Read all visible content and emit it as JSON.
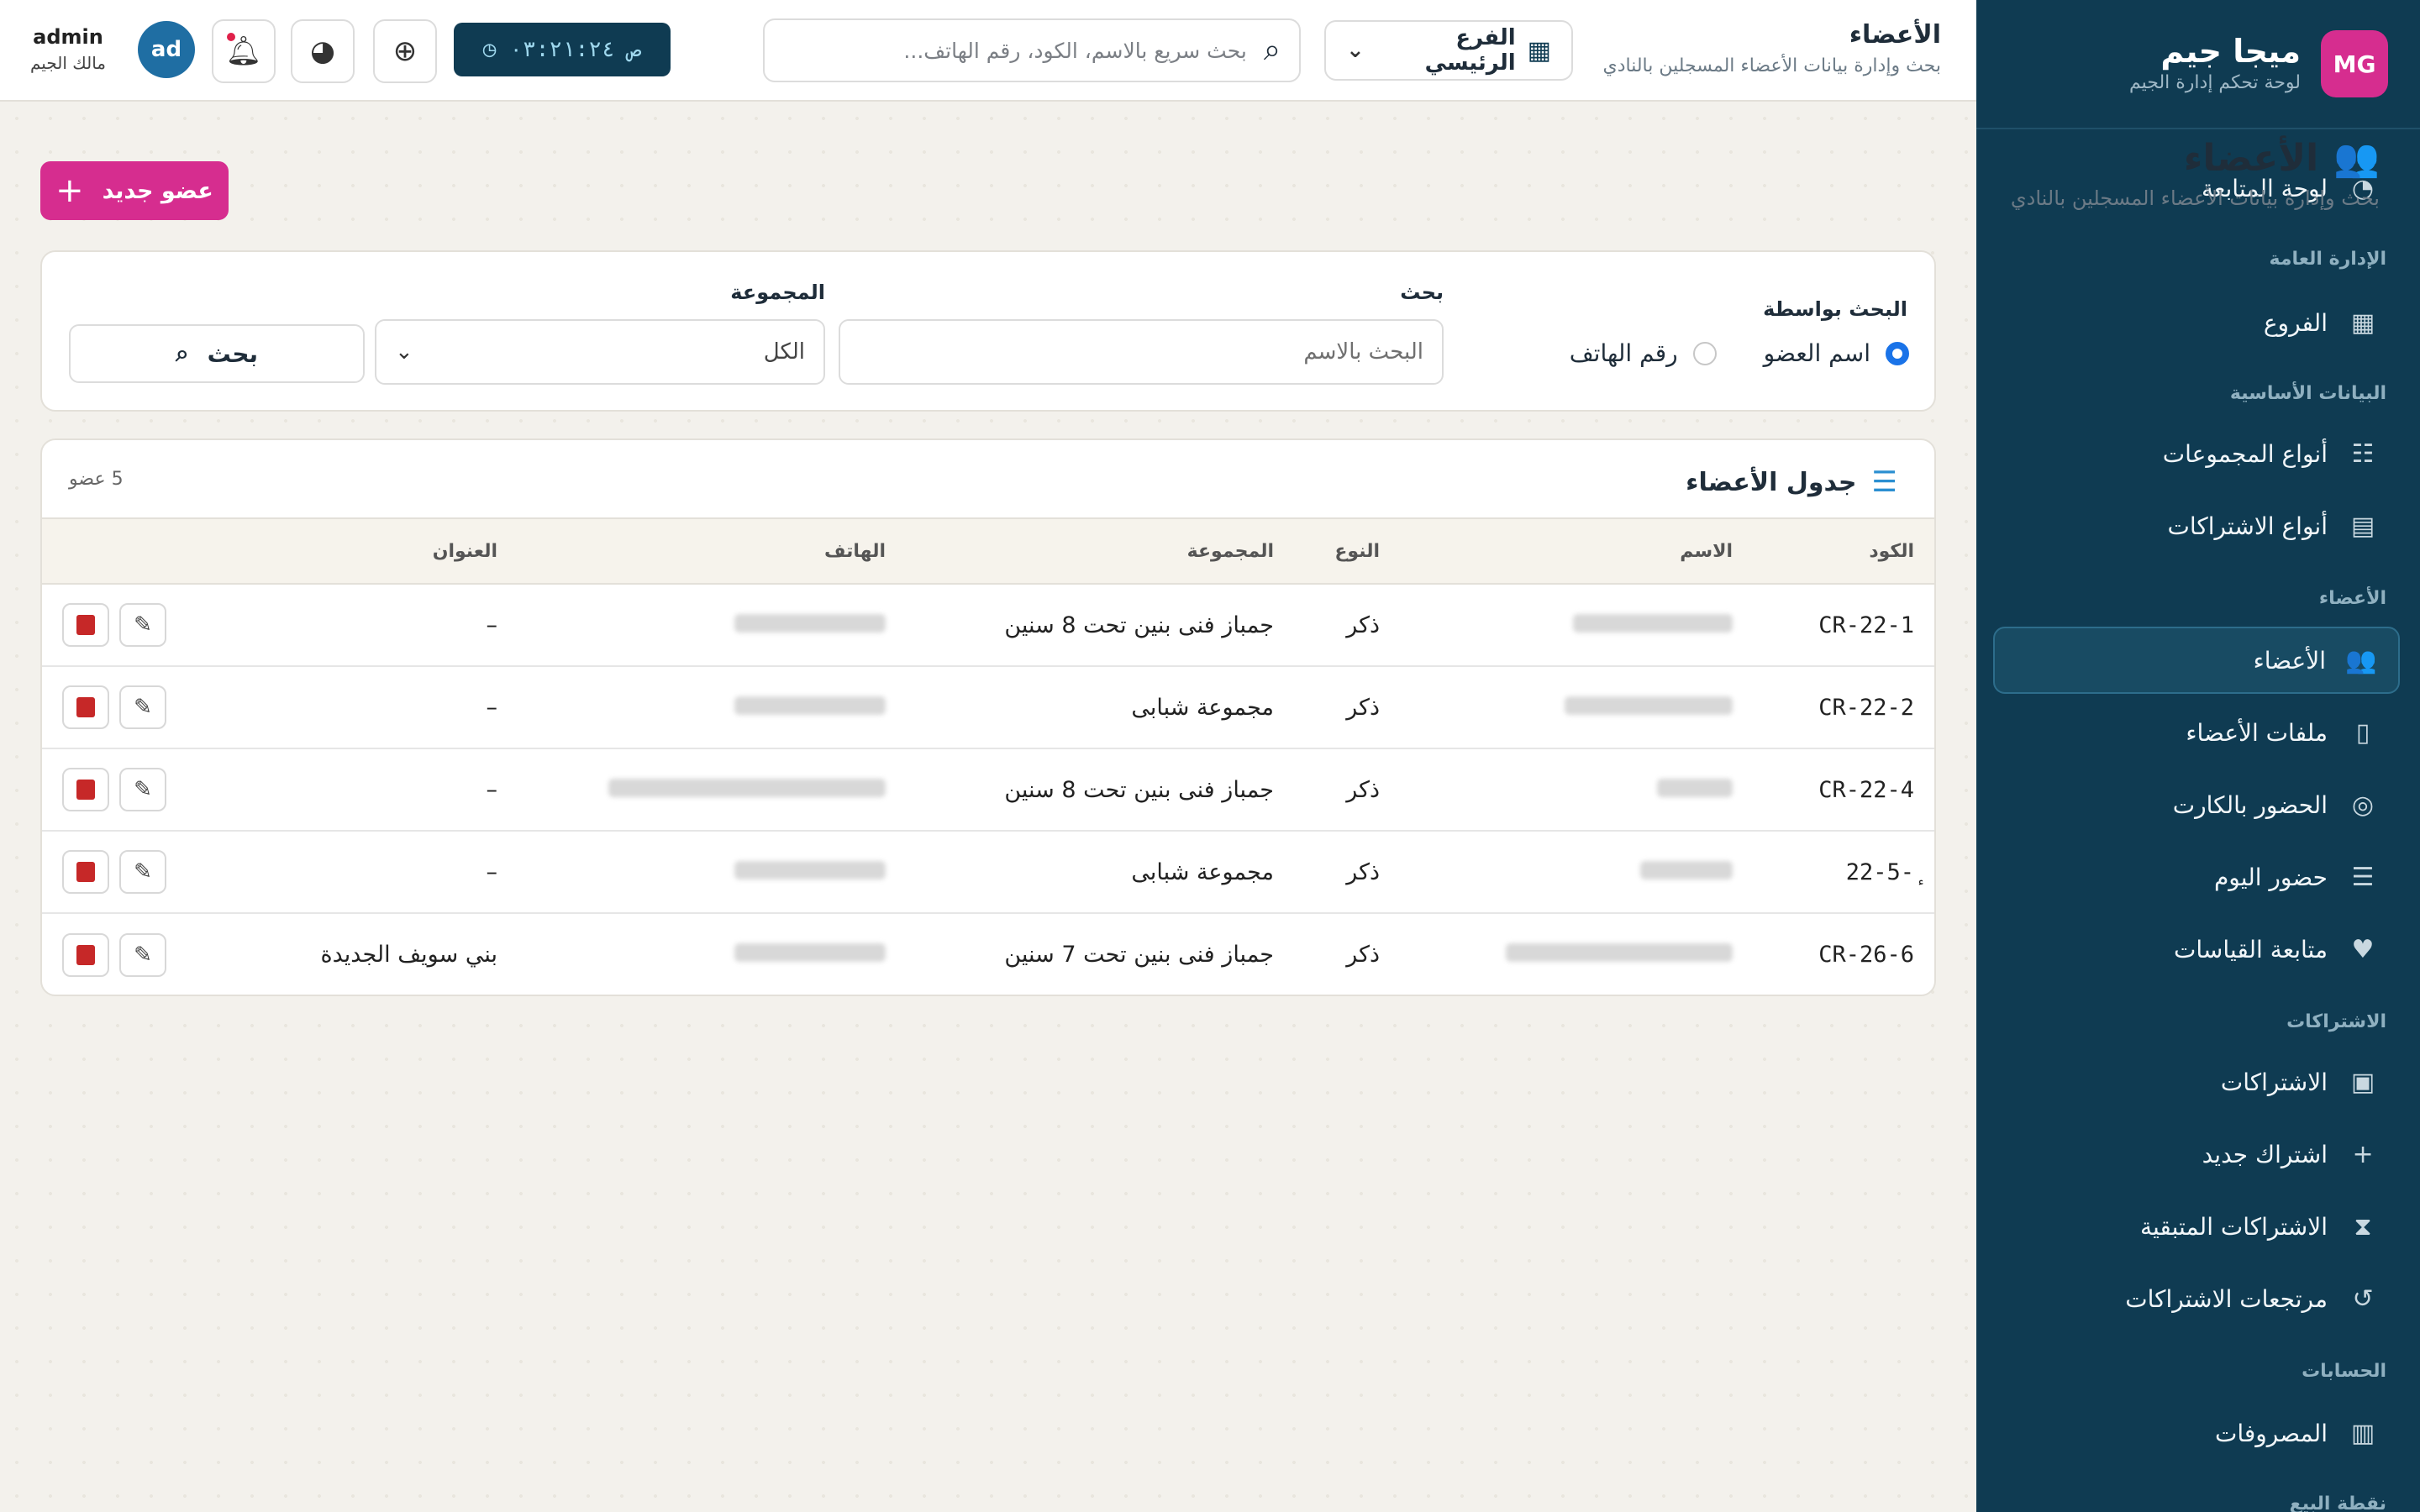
{
  "sidebar": {
    "logo": "MG",
    "title": "ميجا جيم",
    "subtitle": "لوحة تحكم إدارة الجيم",
    "dashboard": "لوحة المتابعة",
    "section_admin": "الإدارة العامة",
    "branches": "الفروع",
    "section_basic": "البيانات الأساسية",
    "group_types": "أنواع المجموعات",
    "sub_types": "أنواع الاشتراكات",
    "section_members": "الأعضاء",
    "members": "الأعضاء",
    "member_files": "ملفات الأعضاء",
    "card_attendance": "الحضور بالكارت",
    "today_attendance": "حضور اليوم",
    "measurements": "متابعة القياسات",
    "section_subs": "الاشتراكات",
    "subscriptions": "الاشتراكات",
    "new_subscription": "اشتراك جديد",
    "remaining_subs": "الاشتراكات المتبقية",
    "sub_returns": "مرتجعات الاشتراكات",
    "section_accounts": "الحسابات",
    "expenses": "المصروفات",
    "section_pos": "نقطة البيع"
  },
  "topbar": {
    "title": "الأعضاء",
    "subtitle": "بحث وإدارة بيانات الأعضاء المسجلين بالنادي",
    "branch": "الفرع الرئيسي",
    "search_placeholder": "بحث سريع بالاسم، الكود، رقم الهاتف...",
    "clock": "٠٣:٢١:٢٤",
    "clock_ampm": "ص",
    "avatar": "ad",
    "username": "admin",
    "role": "مالك الجيم"
  },
  "page": {
    "title": "الأعضاء",
    "subtitle": "بحث وإدارة بيانات الأعضاء المسجلين بالنادي",
    "add_button": "عضو جديد"
  },
  "filter": {
    "search_by_label": "البحث بواسطة",
    "opt_name": "اسم العضو",
    "opt_phone": "رقم الهاتف",
    "search_label": "بحث",
    "search_placeholder": "البحث بالاسم",
    "group_label": "المجموعة",
    "group_value": "الكل",
    "search_button": "بحث"
  },
  "table": {
    "title": "جدول الأعضاء",
    "count": "5 عضو",
    "columns": [
      "الكود",
      "الاسم",
      "النوع",
      "المجموعة",
      "الهاتف",
      "العنوان"
    ],
    "rows": [
      {
        "code": "CR-22-1",
        "type": "ذكر",
        "group": "جمباز فنى بنين تحت 8 سنين",
        "address": "–"
      },
      {
        "code": "CR-22-2",
        "type": "ذكر",
        "group": "مجموعة شبابى",
        "address": "–"
      },
      {
        "code": "CR-22-4",
        "type": "ذكر",
        "group": "جمباز فنى بنين تحت 8 سنين",
        "address": "–"
      },
      {
        "code": "22-5-ٕ",
        "type": "ذكر",
        "group": "مجموعة شبابى",
        "address": "–"
      },
      {
        "code": "CR-26-6",
        "type": "ذكر",
        "group": "جمباز فنى بنين تحت 7 سنين",
        "address": "بني سويف الجديدة"
      }
    ]
  },
  "colors": {
    "sidebar_bg": "#0f3b52",
    "brand_accent": "#d62d8f",
    "icon_blue": "#2b8fd1",
    "danger": "#c62828"
  }
}
